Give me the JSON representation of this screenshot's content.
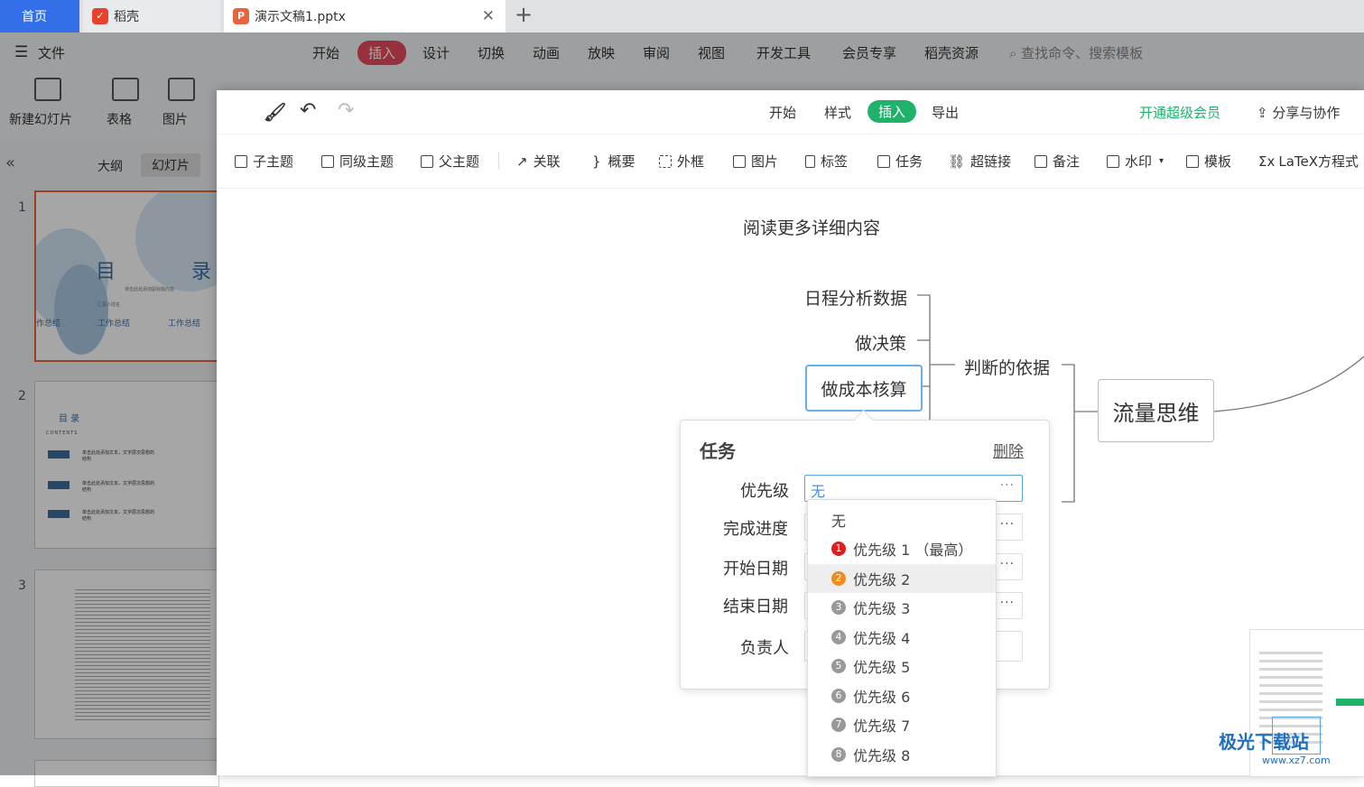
{
  "browser": {
    "tabs": [
      {
        "label": "首页"
      },
      {
        "label": "稻壳"
      },
      {
        "label": "演示文稿1.pptx"
      }
    ],
    "new_tab": "+",
    "close": "✕"
  },
  "ppt": {
    "menu": [
      "文件",
      "开始",
      "插入",
      "设计",
      "切换",
      "动画",
      "放映",
      "审阅",
      "视图",
      "开发工具",
      "会员专享",
      "稻壳资源"
    ],
    "search_placeholder": "查找命令、搜索模板",
    "ribbon": [
      "新建幻灯片",
      "表格",
      "图片"
    ],
    "panel_tabs": [
      "大纲",
      "幻灯片"
    ],
    "slide_numbers": [
      "1",
      "2",
      "3"
    ],
    "slide1": {
      "title_left": "目",
      "title_right": "录",
      "subtitle": "单击此处添加副标题内容",
      "caption": "汇报人姓名",
      "items": [
        "作总结",
        "工作总结",
        "工作总结"
      ]
    },
    "slide2": {
      "title": "目 录",
      "sub": "CONTENTS",
      "items": [
        "单击此处添加文本，文字层次思想的结构",
        "单击此处添加文本，文字层次思想的结构",
        "单击此处添加文本，文字层次思想的结构"
      ]
    }
  },
  "mindmap": {
    "topbar": {
      "tabs": [
        "开始",
        "样式",
        "插入",
        "导出"
      ],
      "active_tab": "插入",
      "vip": "开通超级会员",
      "share": "分享与协作"
    },
    "toolbar": [
      "子主题",
      "同级主题",
      "父主题",
      "关联",
      "概要",
      "外框",
      "图片",
      "标签",
      "任务",
      "超链接",
      "备注",
      "水印",
      "模板",
      "LaTeX方程式"
    ],
    "nodes": {
      "top_text": "阅读更多详细内容",
      "n1": "日程分析数据",
      "n2": "做决策",
      "n3": "做成本核算",
      "n4": "判断的依据",
      "n5": "流量思维"
    },
    "task_panel": {
      "title": "任务",
      "delete": "删除",
      "fields": [
        {
          "label": "优先级",
          "value": "无"
        },
        {
          "label": "完成进度",
          "value": ""
        },
        {
          "label": "开始日期",
          "value": ""
        },
        {
          "label": "结束日期",
          "value": ""
        },
        {
          "label": "负责人",
          "value": ""
        }
      ],
      "more": "···"
    },
    "priority_options": [
      {
        "label": "无",
        "badge": ""
      },
      {
        "label": "优先级 1 （最高）",
        "badge": "1"
      },
      {
        "label": "优先级 2",
        "badge": "2"
      },
      {
        "label": "优先级 3",
        "badge": "3"
      },
      {
        "label": "优先级 4",
        "badge": "4"
      },
      {
        "label": "优先级 5",
        "badge": "5"
      },
      {
        "label": "优先级 6",
        "badge": "6"
      },
      {
        "label": "优先级 7",
        "badge": "7"
      },
      {
        "label": "优先级 8",
        "badge": "8"
      }
    ],
    "highlighted_option": "优先级 2"
  },
  "watermark": {
    "main": "极光下载站",
    "sub": "www.xz7.com"
  },
  "colors": {
    "accent_green": "#20b26b",
    "accent_red": "#e84a5f",
    "tab_blue": "#3370e8",
    "p1": "#e01e1e",
    "p2": "#f08c1e",
    "pgray": "#999999"
  }
}
